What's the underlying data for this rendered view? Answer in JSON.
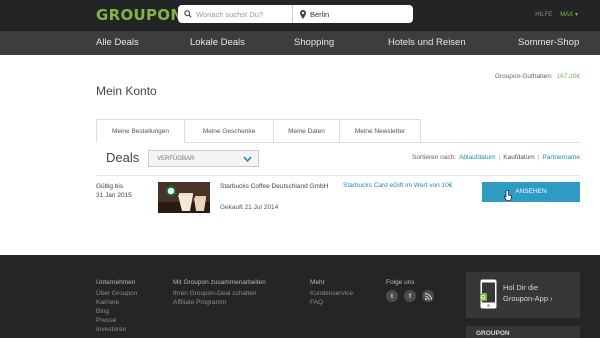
{
  "header": {
    "logo": "GROUPON",
    "search_placeholder": "Wonach suchst Du?",
    "location_value": "Berlin",
    "help_label": "HILFE",
    "user_label": "MAX"
  },
  "nav": {
    "items": [
      "Alle Deals",
      "Lokale Deals",
      "Shopping",
      "Hotels und Reisen",
      "Sommer-Shop"
    ]
  },
  "account": {
    "title": "Mein Konto",
    "balance_label": "Groupon-Guthaben:",
    "balance_value": "167,30€"
  },
  "tabs": [
    "Meine Bestellungen",
    "Meine Geschenke",
    "Meine Daten",
    "Meine Newsletter"
  ],
  "deals": {
    "title": "Deals",
    "filter_selected": "VERFÜGBAR",
    "sort_label": "Sortieren nach:",
    "sort_options": [
      "Ablaufdatum",
      "Kaufdatum",
      "Partnername"
    ]
  },
  "deal_row": {
    "valid_label": "Gültig bis",
    "valid_date": "31 Jan 2015",
    "merchant": "Starbucks Coffee Deutschland GmbH",
    "purchase": "Gekauft 21 Jul 2014",
    "deal_link": "Starbucks Card eGift im Wert von 10€",
    "view_button": "ANSEHEN"
  },
  "footer": {
    "col1": {
      "head": "Unternehmen",
      "items": [
        "Über Groupon",
        "Karriere",
        "Blog",
        "Presse",
        "Investoren"
      ]
    },
    "col2": {
      "head": "Mit Groupon zusammenarbeiten",
      "items": [
        "Ihren Groupon-Deal schalten",
        "Affiliate Programm"
      ]
    },
    "col3": {
      "head": "Mehr",
      "items": [
        "Kundenservice",
        "FAQ"
      ]
    },
    "col4": {
      "head": "Folge uns"
    },
    "social": [
      "twitter-icon",
      "facebook-icon",
      "rss-icon"
    ],
    "app_line1": "Hol Dir die",
    "app_line2": "Groupon-App ›",
    "app2_label": "GROUPON"
  },
  "colors": {
    "brand_green": "#82b548",
    "link_blue": "#2a86b4",
    "button_blue": "#2e9bc4",
    "header_bg": "#222426",
    "nav_bg": "#3b3d3f",
    "footer_bg": "#232527"
  }
}
